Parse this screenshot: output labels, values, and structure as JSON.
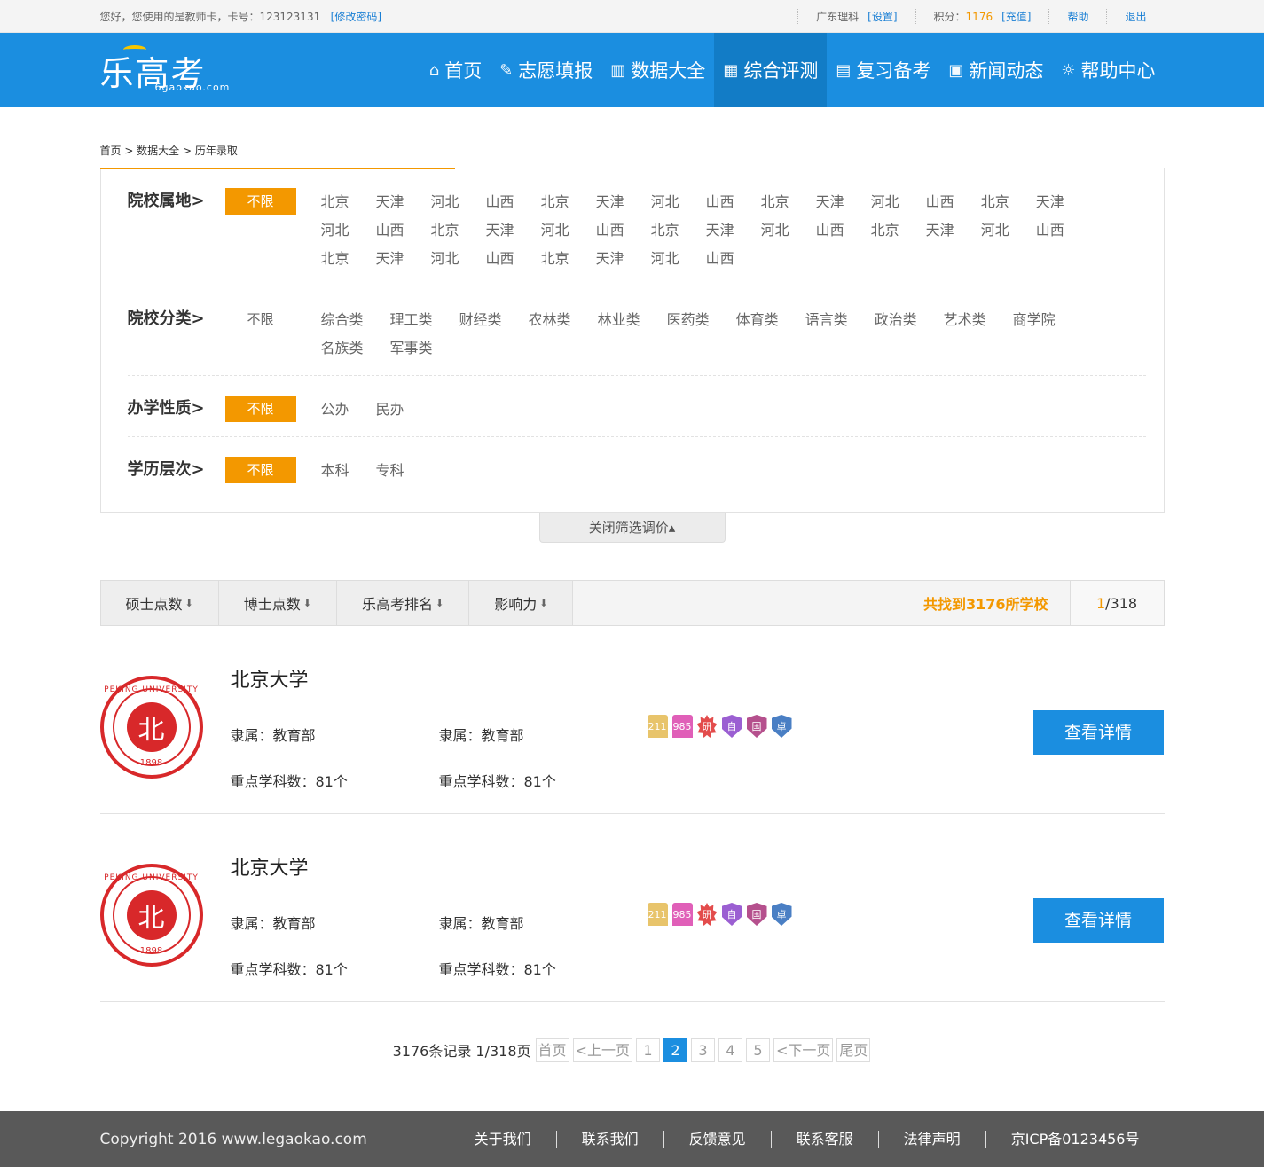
{
  "topbar": {
    "greeting": "您好，您使用的是教师卡，卡号：123123131",
    "change_pwd": "[修改密码]",
    "region": "广东理科",
    "settings": "[设置]",
    "points_label": "积分：",
    "points_value": "1176",
    "recharge": "[充值]",
    "help": "帮助",
    "logout": "退出"
  },
  "logo": {
    "text": "乐高考",
    "sub": "6gaokao.com"
  },
  "nav": [
    {
      "label": "首页",
      "icon": "home-icon",
      "glyph": "⌂"
    },
    {
      "label": "志愿填报",
      "icon": "pen-icon",
      "glyph": "✎"
    },
    {
      "label": "数据大全",
      "icon": "bar-chart-icon",
      "glyph": "▥"
    },
    {
      "label": "综合评测",
      "icon": "grid-icon",
      "glyph": "▦"
    },
    {
      "label": "复习备考",
      "icon": "book-icon",
      "glyph": "▤"
    },
    {
      "label": "新闻动态",
      "icon": "news-icon",
      "glyph": "▣"
    },
    {
      "label": "帮助中心",
      "icon": "bulb-icon",
      "glyph": "☼"
    }
  ],
  "breadcrumb": "首页 > 数据大全 > 历年录取",
  "filters": {
    "location": {
      "label": "院校属地>",
      "all": "不限",
      "options": [
        "北京",
        "天津",
        "河北",
        "山西",
        "北京",
        "天津",
        "河北",
        "山西",
        "北京",
        "天津",
        "河北",
        "山西",
        "北京",
        "天津",
        "河北",
        "山西",
        "北京",
        "天津",
        "河北",
        "山西",
        "北京",
        "天津",
        "河北",
        "山西",
        "北京",
        "天津",
        "河北",
        "山西",
        "北京",
        "天津",
        "河北",
        "山西",
        "北京",
        "天津",
        "河北",
        "山西"
      ]
    },
    "category": {
      "label": "院校分类>",
      "all": "不限",
      "options": [
        "综合类",
        "理工类",
        "财经类",
        "农林类",
        "林业类",
        "医药类",
        "体育类",
        "语言类",
        "政治类",
        "艺术类",
        "商学院",
        "名族类",
        "军事类"
      ]
    },
    "nature": {
      "label": "办学性质>",
      "all": "不限",
      "options": [
        "公办",
        "民办"
      ]
    },
    "level": {
      "label": "学历层次>",
      "all": "不限",
      "options": [
        "本科",
        "专科"
      ]
    }
  },
  "toggle": "关闭筛选调价▴",
  "sort": {
    "items": [
      "硕士点数",
      "博士点数",
      "乐高考排名",
      "影响力"
    ],
    "arrow": "⬇",
    "found": "共找到3176所学校",
    "page_cur": "1",
    "page_total": "/318"
  },
  "schools": [
    {
      "name": "北京大学",
      "affil1": "隶属：教育部",
      "affil2": "隶属：教育部",
      "key1": "重点学科数：81个",
      "key2": "重点学科数：81个",
      "seal_name": "PEKING UNIVERSITY",
      "seal_year": "1898",
      "seal_core": "北",
      "tags": [
        "211",
        "985",
        "研",
        "自",
        "国",
        "卓"
      ],
      "button": "查看详情"
    },
    {
      "name": "北京大学",
      "affil1": "隶属：教育部",
      "affil2": "隶属：教育部",
      "key1": "重点学科数：81个",
      "key2": "重点学科数：81个",
      "seal_name": "PEKING UNIVERSITY",
      "seal_year": "1898",
      "seal_core": "北",
      "tags": [
        "211",
        "985",
        "研",
        "自",
        "国",
        "卓"
      ],
      "button": "查看详情"
    }
  ],
  "pager": {
    "summary": "3176条记录 1/318页",
    "first": "首页",
    "prev": "<上一页",
    "pages": [
      "1",
      "2",
      "3",
      "4",
      "5"
    ],
    "current": "2",
    "next": "<下一页",
    "last": "尾页"
  },
  "footer": {
    "copyright": "Copyright 2016 www.legaokao.com",
    "links": [
      "关于我们",
      "联系我们",
      "反馈意见",
      "联系客服",
      "法律声明",
      "京ICP备0123456号"
    ]
  }
}
